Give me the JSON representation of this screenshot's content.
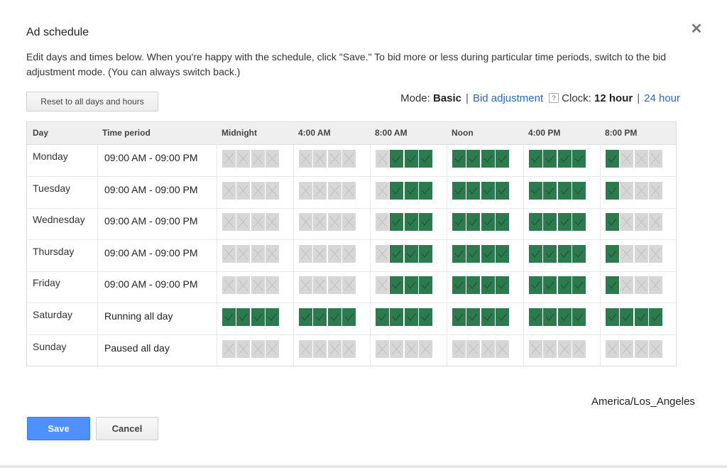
{
  "dialog": {
    "title": "Ad schedule",
    "close_symbol": "✕",
    "description": "Edit days and times below. When you're happy with the schedule, click \"Save.\" To bid more or less during particular time periods, switch to the bid adjustment mode. (You can always switch back.)"
  },
  "toolbar": {
    "reset_label": "Reset to all days and hours",
    "mode_label": "Mode:",
    "mode_basic": "Basic",
    "mode_bid": "Bid adjustment",
    "help_symbol": "?",
    "clock_label": "Clock:",
    "clock_12": "12 hour",
    "clock_24": "24 hour",
    "separator": "|"
  },
  "table": {
    "headers": [
      "Day",
      "Time period",
      "Midnight",
      "4:00 AM",
      "8:00 AM",
      "Noon",
      "4:00 PM",
      "8:00 PM"
    ],
    "rows": [
      {
        "day": "Monday",
        "period": "09:00 AM - 09:00 PM",
        "hours": "000000000111111111111000"
      },
      {
        "day": "Tuesday",
        "period": "09:00 AM - 09:00 PM",
        "hours": "000000000111111111111000"
      },
      {
        "day": "Wednesday",
        "period": "09:00 AM - 09:00 PM",
        "hours": "000000000111111111111000"
      },
      {
        "day": "Thursday",
        "period": "09:00 AM - 09:00 PM",
        "hours": "000000000111111111111000"
      },
      {
        "day": "Friday",
        "period": "09:00 AM - 09:00 PM",
        "hours": "000000000111111111111000"
      },
      {
        "day": "Saturday",
        "period": "Running all day",
        "hours": "111111111111111111111111"
      },
      {
        "day": "Sunday",
        "period": "Paused all day",
        "hours": "000000000000000000000000"
      }
    ]
  },
  "footer": {
    "timezone": "America/Los_Angeles",
    "save_label": "Save",
    "cancel_label": "Cancel"
  },
  "colors": {
    "active_slot": "#2e7a4f",
    "inactive_slot": "#d7d7d7",
    "primary_button": "#4d90fe",
    "link": "#2a66c8"
  },
  "icons": {
    "active_slot": "check-icon",
    "inactive_slot": "cross-icon",
    "close": "close-icon",
    "help": "help-icon"
  }
}
